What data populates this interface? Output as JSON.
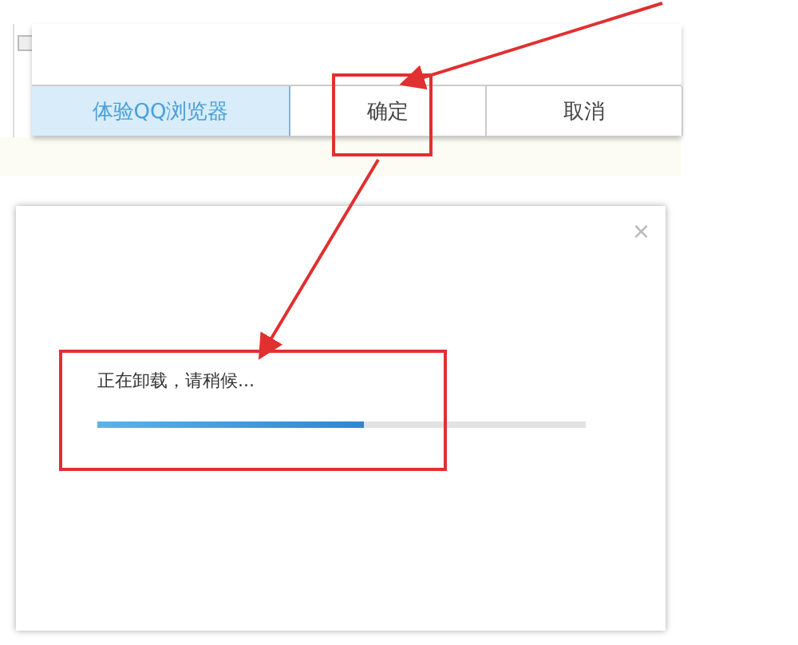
{
  "top_dialog": {
    "buttons": [
      {
        "label": "体验QQ浏览器",
        "kind": "highlight"
      },
      {
        "label": "确定",
        "kind": "plain"
      },
      {
        "label": "取消",
        "kind": "plain"
      }
    ]
  },
  "progress_dialog": {
    "close": "×",
    "message": "正在卸载，请稍候...",
    "progress": {
      "level": 0.545
    }
  }
}
